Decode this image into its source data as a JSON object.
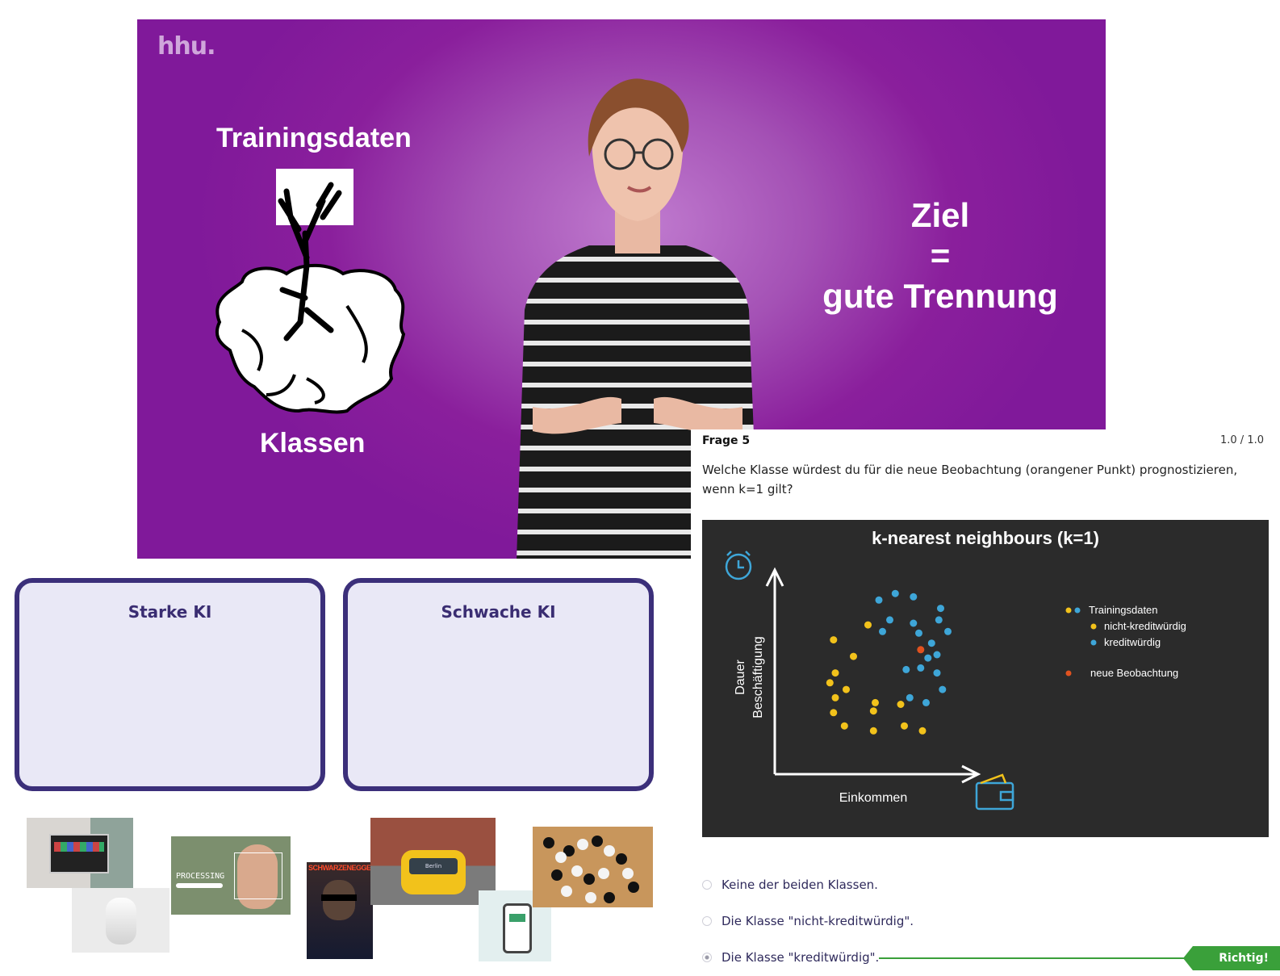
{
  "video": {
    "logo": "hhu.",
    "slide_heading": "Trainingsdaten",
    "slide_footer": "Klassen",
    "goal_line1": "Ziel",
    "goal_line2": "=",
    "goal_line3": "gute Trennung"
  },
  "sorting": {
    "zones": [
      {
        "label": "Starke KI"
      },
      {
        "label": "Schwache KI"
      }
    ],
    "processing_text": "PROCESSING",
    "poster_text": "SCHWARZENEGGER",
    "bus_text": "Berlin"
  },
  "quiz": {
    "title": "Frage 5",
    "score": "1.0 / 1.0",
    "question": "Welche Klasse würdest du für die neue Beobachtung (orangener Punkt) prognostizieren, wenn k=1 gilt?",
    "options": [
      {
        "label": "Keine der beiden Klassen.",
        "selected": false
      },
      {
        "label": "Die Klasse \"nicht-kreditwürdig\".",
        "selected": false
      },
      {
        "label": "Die Klasse \"kreditwürdig\".",
        "selected": true
      }
    ],
    "feedback": "Richtig!",
    "colors": {
      "correct": "#3aa03a",
      "yellow": "#f2c21b",
      "blue": "#3ea6d8",
      "orange": "#e0521f"
    }
  },
  "chart_data": {
    "type": "scatter",
    "title": "k-nearest neighbours (k=1)",
    "xlabel": "Einkommen",
    "ylabel": "Dauer Beschäftigung",
    "legend_placement": "right",
    "legend": {
      "header": "Trainingsdaten",
      "entries": [
        "nicht-kreditwürdig",
        "kreditwürdig",
        "neue Beobachtung"
      ]
    },
    "xlim": [
      0,
      100
    ],
    "ylim": [
      0,
      100
    ],
    "series": [
      {
        "name": "nicht-kreditwürdig",
        "color": "#f2c21b",
        "points": [
          [
            19,
            69
          ],
          [
            38,
            78
          ],
          [
            20,
            49
          ],
          [
            30,
            59
          ],
          [
            17,
            43
          ],
          [
            26,
            39
          ],
          [
            42,
            31
          ],
          [
            20,
            34
          ],
          [
            41,
            26
          ],
          [
            56,
            30
          ],
          [
            19,
            25
          ],
          [
            25,
            17
          ],
          [
            41,
            14
          ],
          [
            58,
            17
          ],
          [
            68,
            14
          ]
        ]
      },
      {
        "name": "kreditwürdig",
        "color": "#3ea6d8",
        "points": [
          [
            44,
            93
          ],
          [
            53,
            97
          ],
          [
            63,
            95
          ],
          [
            78,
            88
          ],
          [
            77,
            81
          ],
          [
            63,
            79
          ],
          [
            82,
            74
          ],
          [
            66,
            73
          ],
          [
            46,
            74
          ],
          [
            50,
            81
          ],
          [
            73,
            67
          ],
          [
            76,
            60
          ],
          [
            71,
            58
          ],
          [
            67,
            52
          ],
          [
            76,
            49
          ],
          [
            59,
            51
          ],
          [
            79,
            39
          ],
          [
            61,
            34
          ],
          [
            70,
            31
          ]
        ]
      },
      {
        "name": "neue Beobachtung",
        "color": "#e0521f",
        "points": [
          [
            67,
            63
          ]
        ]
      }
    ]
  }
}
